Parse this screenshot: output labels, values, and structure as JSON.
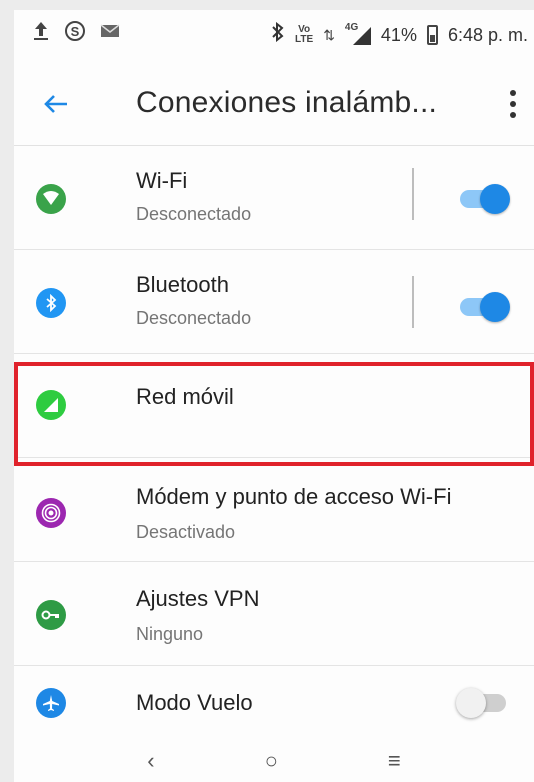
{
  "status_bar": {
    "left_icons": [
      "upload-icon",
      "skype-icon",
      "message-icon"
    ],
    "volte_top": "Vo",
    "volte_bottom": "LTE",
    "network": "4G",
    "battery": "41%",
    "time": "6:48 p. m."
  },
  "app_bar": {
    "title": "Conexiones inalámb..."
  },
  "items": [
    {
      "label": "Wi-Fi",
      "sub": "Desconectado",
      "toggle": true,
      "icon": "wifi-icon",
      "color": "#3aa34a"
    },
    {
      "label": "Bluetooth",
      "sub": "Desconectado",
      "toggle": true,
      "icon": "bluetooth-icon",
      "color": "#2196f3"
    },
    {
      "label": "Red móvil",
      "sub": "",
      "icon": "mobile-network-icon",
      "color": "#2ecc40"
    },
    {
      "label": "Módem y punto de acceso Wi-Fi",
      "sub": "Desactivado",
      "icon": "hotspot-icon",
      "color": "#9c27b0"
    },
    {
      "label": "Ajustes VPN",
      "sub": "Ninguno",
      "icon": "vpn-key-icon",
      "color": "#2e9b45"
    },
    {
      "label": "Modo Vuelo",
      "sub": "",
      "toggle": false,
      "icon": "airplane-icon",
      "color": "#1e88e5"
    }
  ],
  "nav": {
    "back": "‹",
    "home": "○",
    "recents": "≡"
  }
}
